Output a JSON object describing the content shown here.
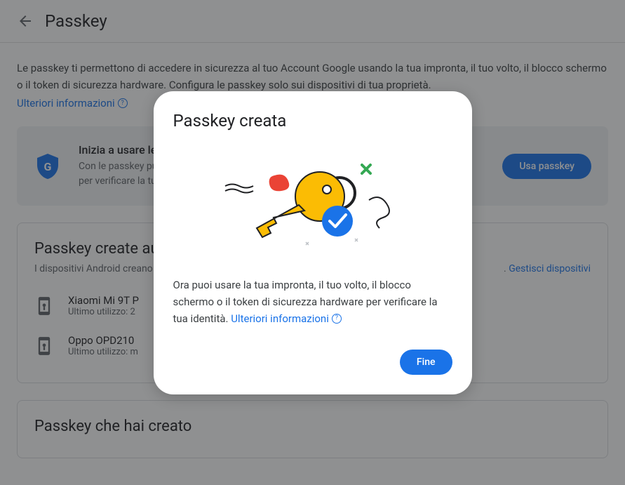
{
  "header": {
    "title": "Passkey"
  },
  "intro": {
    "text": "Le passkey ti permettono di accedere in sicurezza al tuo Account Google usando la tua impronta, il tuo volto, il blocco schermo o il token di sicurezza hardware. Configura le passkey solo sui dispositivi di tua proprietà.",
    "learn_more": "Ulteriori informazioni"
  },
  "promo": {
    "title": "Inizia a usare le",
    "desc_line1": "Con le passkey pu",
    "desc_line2": "per verificare la tu",
    "button": "Usa passkey"
  },
  "auto_section": {
    "title": "Passkey create au",
    "subtitle": "I dispositivi Android creano",
    "subtitle_end": ".",
    "manage_link": "Gestisci dispositivi",
    "devices": [
      {
        "name": "Xiaomi Mi 9T P",
        "last_used": "Ultimo utilizzo: 2"
      },
      {
        "name": "Oppo OPD210",
        "last_used": "Ultimo utilizzo: m"
      }
    ]
  },
  "created_section": {
    "title": "Passkey che hai creato"
  },
  "modal": {
    "title": "Passkey creata",
    "text": "Ora puoi usare la tua impronta, il tuo volto, il blocco schermo o il token di sicurezza hardware per verificare la tua identità. ",
    "learn_more": "Ulteriori informazioni",
    "button": "Fine"
  }
}
